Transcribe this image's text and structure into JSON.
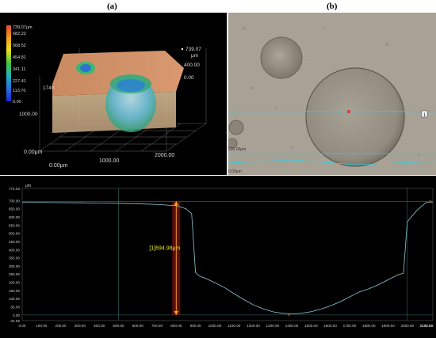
{
  "labels": {
    "a": "(a)",
    "b": "(b)"
  },
  "colorbar": {
    "max": "739.07μm",
    "ticks": [
      "682.22",
      "568.52",
      "454.81",
      "341.11",
      "227.41",
      "113.70",
      "0.00"
    ]
  },
  "surface3d": {
    "z_top": "739.07",
    "z_unit": "μm",
    "z_mid": "400.00",
    "z_zero": "0.00",
    "y_label": "1749.",
    "y_tick": "1000.00",
    "origin_y": "0.00μm",
    "origin_x": "0.00μm",
    "x_mid": "1000.00",
    "x_end": "2000.00"
  },
  "photo": {
    "marker": "1",
    "scale_top": "500.00μm",
    "scale_bottom": "0.00μm"
  },
  "chart_data": {
    "type": "line",
    "title": "",
    "xlabel": "",
    "ylabel": "μm",
    "y_top_tick": "774.03",
    "x_end_tick": "2132.63",
    "y_bottom_tick": "-34.55",
    "xlim": [
      0,
      2132.63
    ],
    "ylim": [
      -34.55,
      774.03
    ],
    "x_ticks": [
      "0.00",
      "100.00",
      "200.00",
      "300.00",
      "400.00",
      "500.00",
      "600.00",
      "700.00",
      "800.00",
      "900.00",
      "1000.00",
      "1100.00",
      "1200.00",
      "1300.00",
      "1400.00",
      "1500.00",
      "1600.00",
      "1700.00",
      "1800.00",
      "1900.00",
      "2000.00",
      "2100.00"
    ],
    "y_ticks": [
      "700.00",
      "650.00",
      "600.00",
      "550.00",
      "500.00",
      "450.00",
      "400.00",
      "350.00",
      "300.00",
      "250.00",
      "200.00",
      "150.00",
      "100.00",
      "50.00",
      "0.00"
    ],
    "grid": false,
    "series": [
      {
        "x": [
          0,
          100,
          200,
          300,
          400,
          500,
          600,
          700,
          800,
          850,
          880,
          900,
          920,
          950,
          1000,
          1050,
          1100,
          1150,
          1200,
          1250,
          1300,
          1350,
          1400,
          1450,
          1500,
          1550,
          1600,
          1650,
          1700,
          1750,
          1800,
          1850,
          1900,
          1950,
          1980,
          2000,
          2050,
          2100,
          2132
        ],
        "y": [
          688,
          688,
          687,
          686,
          684,
          683,
          680,
          676,
          668,
          650,
          620,
          260,
          238,
          225,
          198,
          168,
          130,
          95,
          62,
          38,
          20,
          10,
          6,
          10,
          20,
          35,
          55,
          80,
          110,
          140,
          160,
          185,
          215,
          245,
          255,
          570,
          640,
          690,
          690
        ]
      }
    ],
    "measurement": {
      "label": "[1]694.98μm",
      "x": 800,
      "y_from": 0,
      "y_to": 694.98
    },
    "markers": [
      {
        "x": 1385,
        "y": 0
      },
      {
        "x": 2250,
        "y": 694.98
      }
    ],
    "vertical_lines": [
      500,
      2000
    ]
  }
}
